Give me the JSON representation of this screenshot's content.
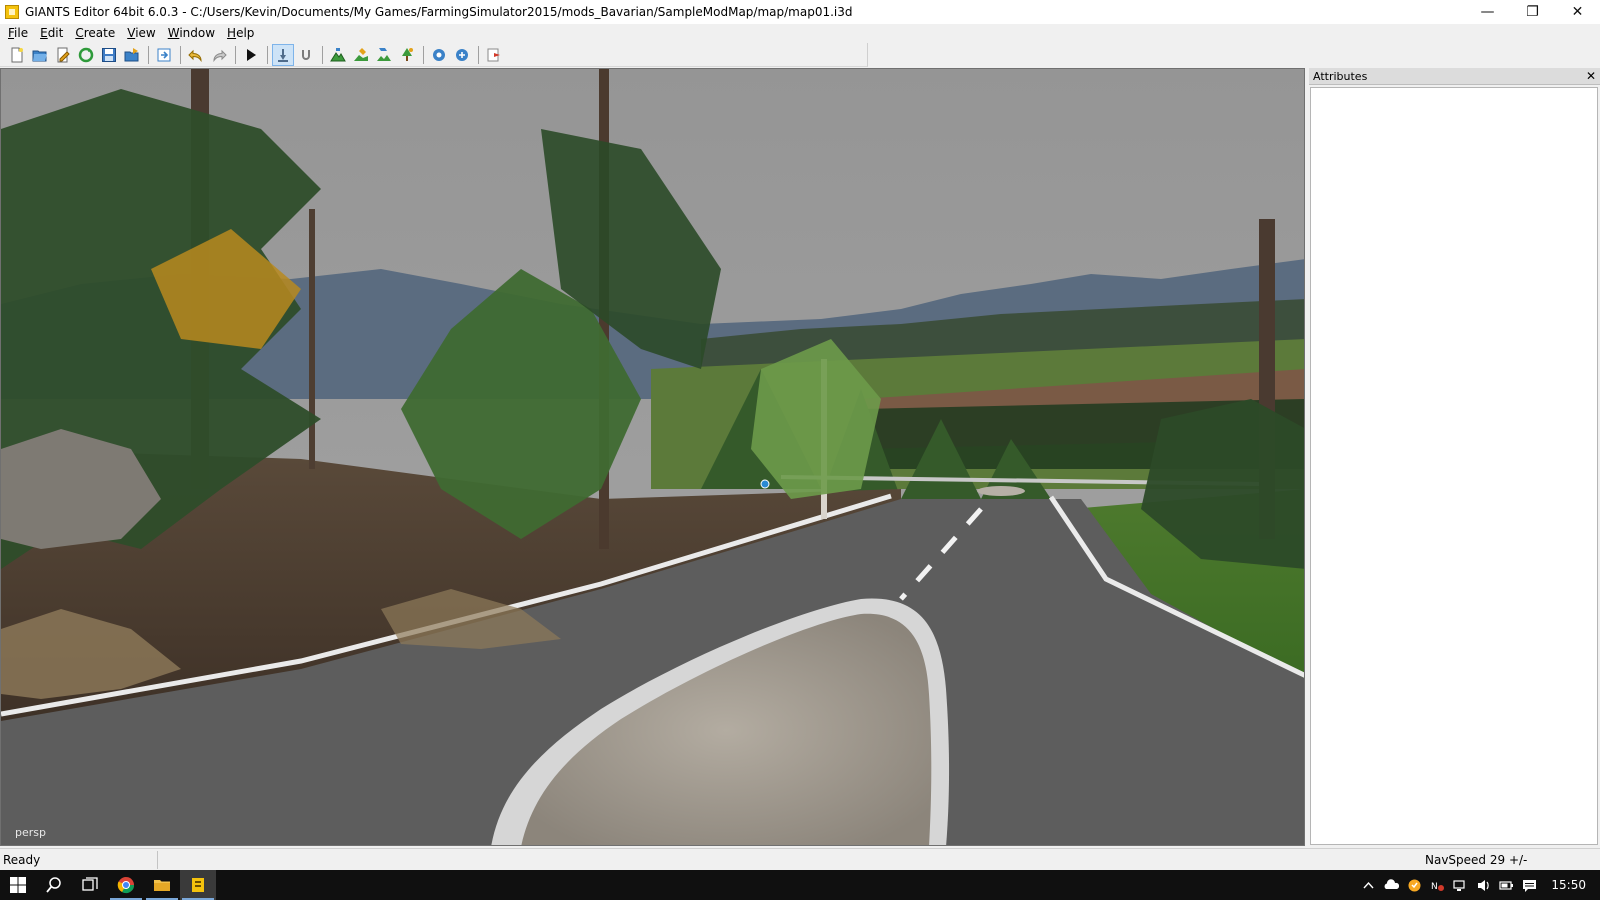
{
  "window": {
    "title": "GIANTS Editor 64bit 6.0.3 - C:/Users/Kevin/Documents/My Games/FarmingSimulator2015/mods_Bavarian/SampleModMap/map/map01.i3d",
    "minimize_glyph": "—",
    "maximize_glyph": "❐",
    "close_glyph": "✕"
  },
  "menubar": {
    "items": [
      {
        "label_first": "F",
        "label_rest": "ile"
      },
      {
        "label_first": "E",
        "label_rest": "dit"
      },
      {
        "label_first": "C",
        "label_rest": "reate"
      },
      {
        "label_first": "V",
        "label_rest": "iew"
      },
      {
        "label_first": "W",
        "label_rest": "indow"
      },
      {
        "label_first": "H",
        "label_rest": "elp"
      }
    ]
  },
  "toolbar": {
    "icons": [
      "new-file-icon",
      "open-folder-icon",
      "edit-file-icon",
      "refresh-icon",
      "save-icon",
      "save-as-icon",
      "import-icon",
      "undo-icon",
      "redo-icon",
      "play-icon",
      "select-mode-icon",
      "magnet-icon",
      "terrain-sculpt-icon",
      "terrain-paint-icon",
      "foliage-paint-icon",
      "tree-paint-icon",
      "script-icon",
      "script-settings-icon",
      "exit-icon"
    ]
  },
  "viewport": {
    "camera_label": "persp"
  },
  "attributes_panel": {
    "title": "Attributes",
    "close_glyph": "✕"
  },
  "statusbar": {
    "status": "Ready",
    "nav_speed": "NavSpeed 29 +/-"
  },
  "taskbar": {
    "clock": "15:50",
    "apps": [
      "windows-start-icon",
      "search-icon",
      "task-view-icon",
      "chrome-icon",
      "file-explorer-icon",
      "giants-editor-icon"
    ],
    "tray": [
      "tray-chevron-icon",
      "onedrive-icon",
      "security-icon",
      "language-icon",
      "network-icon",
      "volume-icon",
      "battery-icon",
      "action-center-icon"
    ]
  },
  "colors": {
    "sky": "#9b9b9b",
    "taskbar": "#101010",
    "accent": "#7aa7d8",
    "app_icon": "#f4c20d"
  }
}
